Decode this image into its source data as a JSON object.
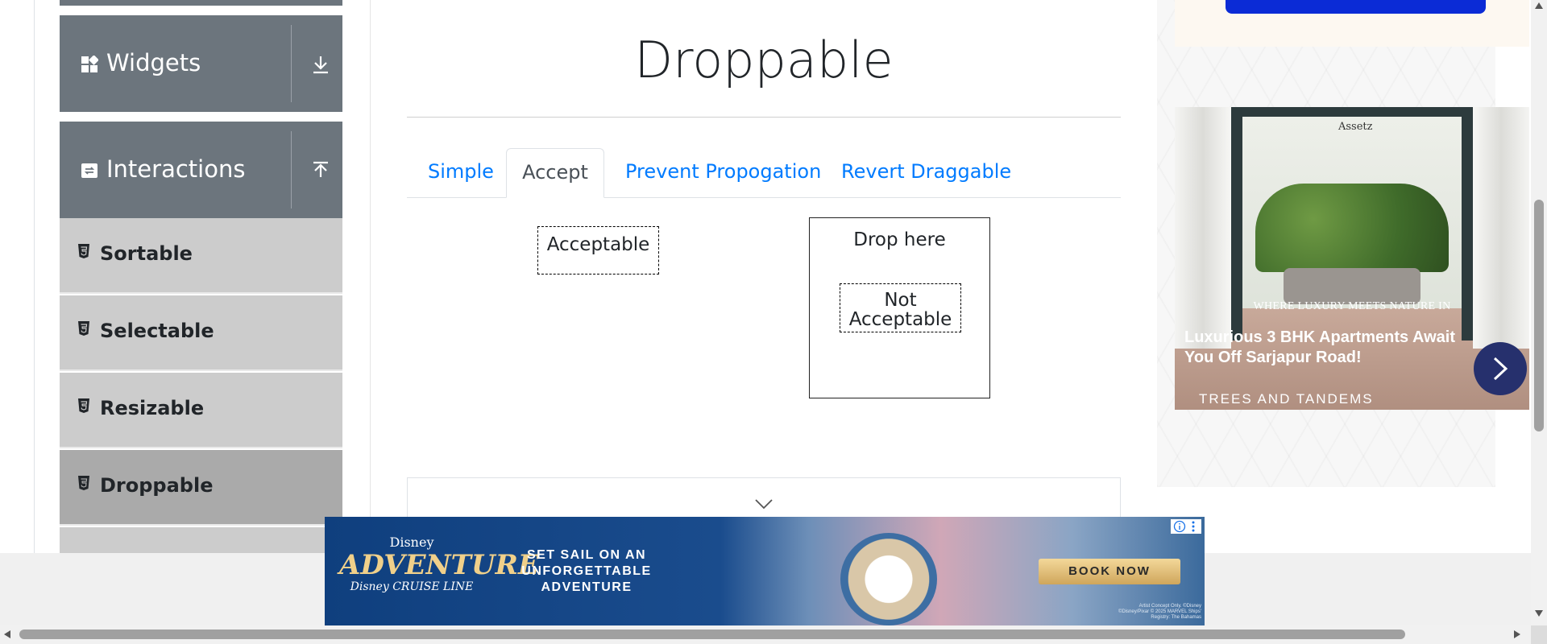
{
  "sidebar": {
    "groups": [
      {
        "label": "Widgets",
        "icon": "widgets-grid-icon",
        "toggle_icon": "download-arrow-icon"
      },
      {
        "label": "Interactions",
        "icon": "interactions-icon",
        "toggle_icon": "upload-arrow-icon"
      }
    ],
    "items": [
      {
        "label": "Sortable",
        "icon": "html5-icon",
        "active": false
      },
      {
        "label": "Selectable",
        "icon": "html5-icon",
        "active": false
      },
      {
        "label": "Resizable",
        "icon": "html5-icon",
        "active": false
      },
      {
        "label": "Droppable",
        "icon": "html5-icon",
        "active": true
      }
    ]
  },
  "main": {
    "title": "Droppable",
    "tabs": [
      {
        "label": "Simple",
        "active": false
      },
      {
        "label": "Accept",
        "active": true
      },
      {
        "label": "Prevent Propogation",
        "active": false
      },
      {
        "label": "Revert Draggable",
        "active": false
      }
    ],
    "draggable_acceptable": "Acceptable",
    "drop_target": "Drop here",
    "draggable_not_acceptable": "Not Acceptable",
    "collapse_icon": "chevron-down-icon"
  },
  "right_ad": {
    "logo": "Assetz",
    "tagline": "WHERE LUXURY MEETS NATURE IN",
    "headline": "Luxurious 3 BHK Apartments Await You Off Sarjapur Road!",
    "brand": "TREES AND TANDEMS",
    "next_icon": "chevron-right-icon"
  },
  "bottom_ad": {
    "logo_top": "Disney",
    "logo_main": "ADVENTURE",
    "logo_bottom": "Disney CRUISE LINE",
    "copy": "SET SAIL ON AN UNFORGETTABLE ADVENTURE",
    "cta": "BOOK NOW",
    "fine_print": "Artist Concept Only. ©Disney ©Disney/Pixar © 2025 MARVEL Ships' Registry: The Bahamas",
    "info_icon": "info-icon",
    "menu_icon": "kebab-menu-icon"
  },
  "colors": {
    "sidebar_group_bg": "#6c757d",
    "sidebar_item_bg": "#cccccc",
    "sidebar_active_bg": "#aaaaaa",
    "tab_link": "#007bff",
    "tab_active_text": "#495057",
    "ad_button_blue": "#0b2bd6"
  }
}
